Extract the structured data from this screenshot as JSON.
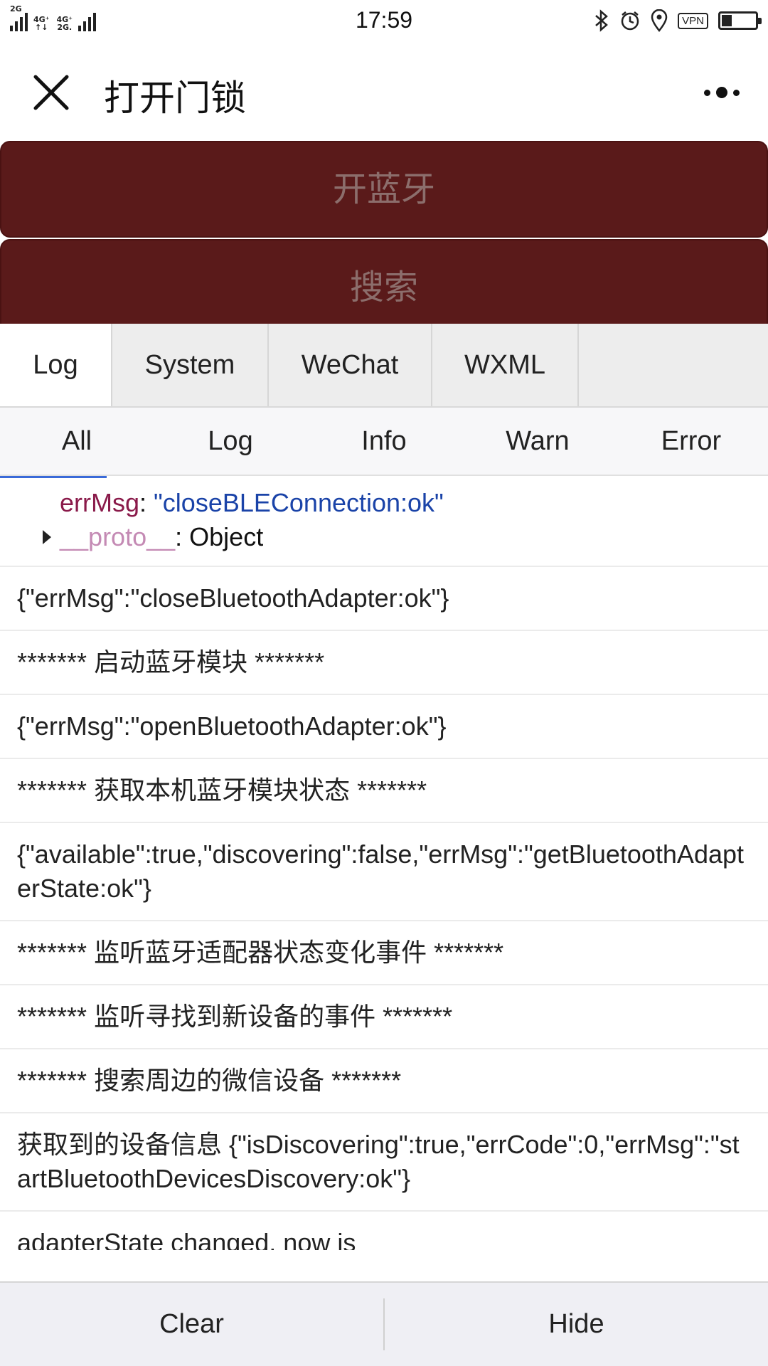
{
  "status_bar": {
    "network_left": "2G",
    "network_mid_top": "4G⁺",
    "network_mid_bottom": "↑↓",
    "network_right_top": "4G⁺",
    "network_right_bottom": "2G.",
    "time": "17:59",
    "vpn_label": "VPN",
    "battery_level": 0.3
  },
  "navbar": {
    "title": "打开门锁"
  },
  "page_buttons": {
    "bluetooth": "开蓝牙",
    "search": "搜索"
  },
  "console": {
    "tabs": [
      "Log",
      "System",
      "WeChat",
      "WXML"
    ],
    "subtabs": [
      "All",
      "Log",
      "Info",
      "Warn",
      "Error"
    ],
    "object": {
      "errmsg_key": "errMsg",
      "errmsg_value": "\"closeBLEConnection:ok\"",
      "proto_key": "__proto__",
      "proto_value": ": Object"
    },
    "logs": [
      "{\"errMsg\":\"closeBluetoothAdapter:ok\"}",
      "******* 启动蓝牙模块 *******",
      "{\"errMsg\":\"openBluetoothAdapter:ok\"}",
      "******* 获取本机蓝牙模块状态 *******",
      "{\"available\":true,\"discovering\":false,\"errMsg\":\"getBluetoothAdapterState:ok\"}",
      "******* 监听蓝牙适配器状态变化事件 *******",
      "******* 监听寻找到新设备的事件 *******",
      "******* 搜索周边的微信设备 *******",
      "获取到的设备信息 {\"isDiscovering\":true,\"errCode\":0,\"errMsg\":\"startBluetoothDevicesDiscovery:ok\"}",
      "adapterState changed, now is"
    ],
    "footer": {
      "clear": "Clear",
      "hide": "Hide"
    }
  }
}
